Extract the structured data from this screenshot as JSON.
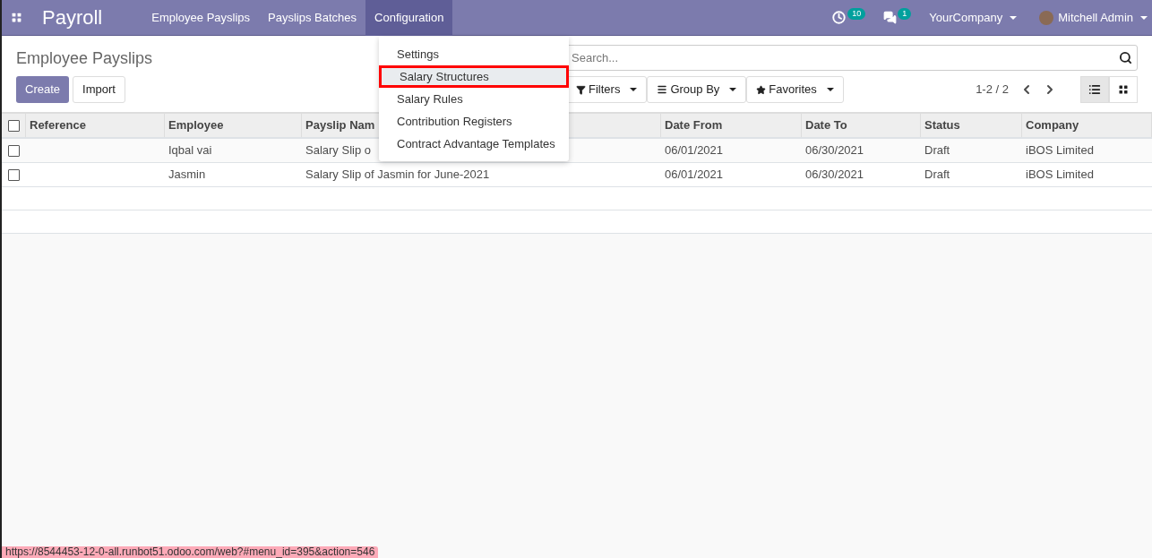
{
  "navbar": {
    "app_title": "Payroll",
    "menus": [
      {
        "label": "Employee Payslips",
        "selected": false
      },
      {
        "label": "Payslips Batches",
        "selected": false
      },
      {
        "label": "Configuration",
        "selected": true
      }
    ],
    "activity_count": "10",
    "message_count": "1",
    "company": "YourCompany",
    "user": "Mitchell Admin"
  },
  "dropdown": {
    "items": [
      {
        "label": "Settings",
        "selected": false
      },
      {
        "label": "Salary Structures",
        "selected": true
      },
      {
        "label": "Salary Rules",
        "selected": false
      },
      {
        "label": "Contribution Registers",
        "selected": false
      },
      {
        "label": "Contract Advantage Templates",
        "selected": false
      }
    ]
  },
  "control_panel": {
    "title": "Employee Payslips",
    "buttons": [
      "Create",
      "Import"
    ],
    "search": {
      "placeholder": "Search..."
    },
    "filters": [
      "Filters",
      "Group By",
      "Favorites"
    ],
    "pager": "1-2 / 2",
    "views": [
      {
        "kind": "list",
        "selected": true
      },
      {
        "kind": "kanban",
        "selected": false
      }
    ]
  },
  "table": {
    "all_checked": false,
    "columns": [
      "Reference",
      "Employee",
      "Payslip Nam",
      "Date From",
      "Date To",
      "Status",
      "Company"
    ],
    "rows": [
      {
        "checked": false,
        "cells": [
          "",
          "Iqbal vai",
          "Salary Slip o",
          "06/01/2021",
          "06/30/2021",
          "Draft",
          "iBOS Limited"
        ]
      },
      {
        "checked": false,
        "cells": [
          "",
          "Jasmin",
          "Salary Slip of Jasmin for June-2021",
          "06/01/2021",
          "06/30/2021",
          "Draft",
          "iBOS Limited"
        ]
      }
    ]
  },
  "status_url": "https://8544453-12-0-all.runbot51.odoo.com/web?#menu_id=395&action=546"
}
